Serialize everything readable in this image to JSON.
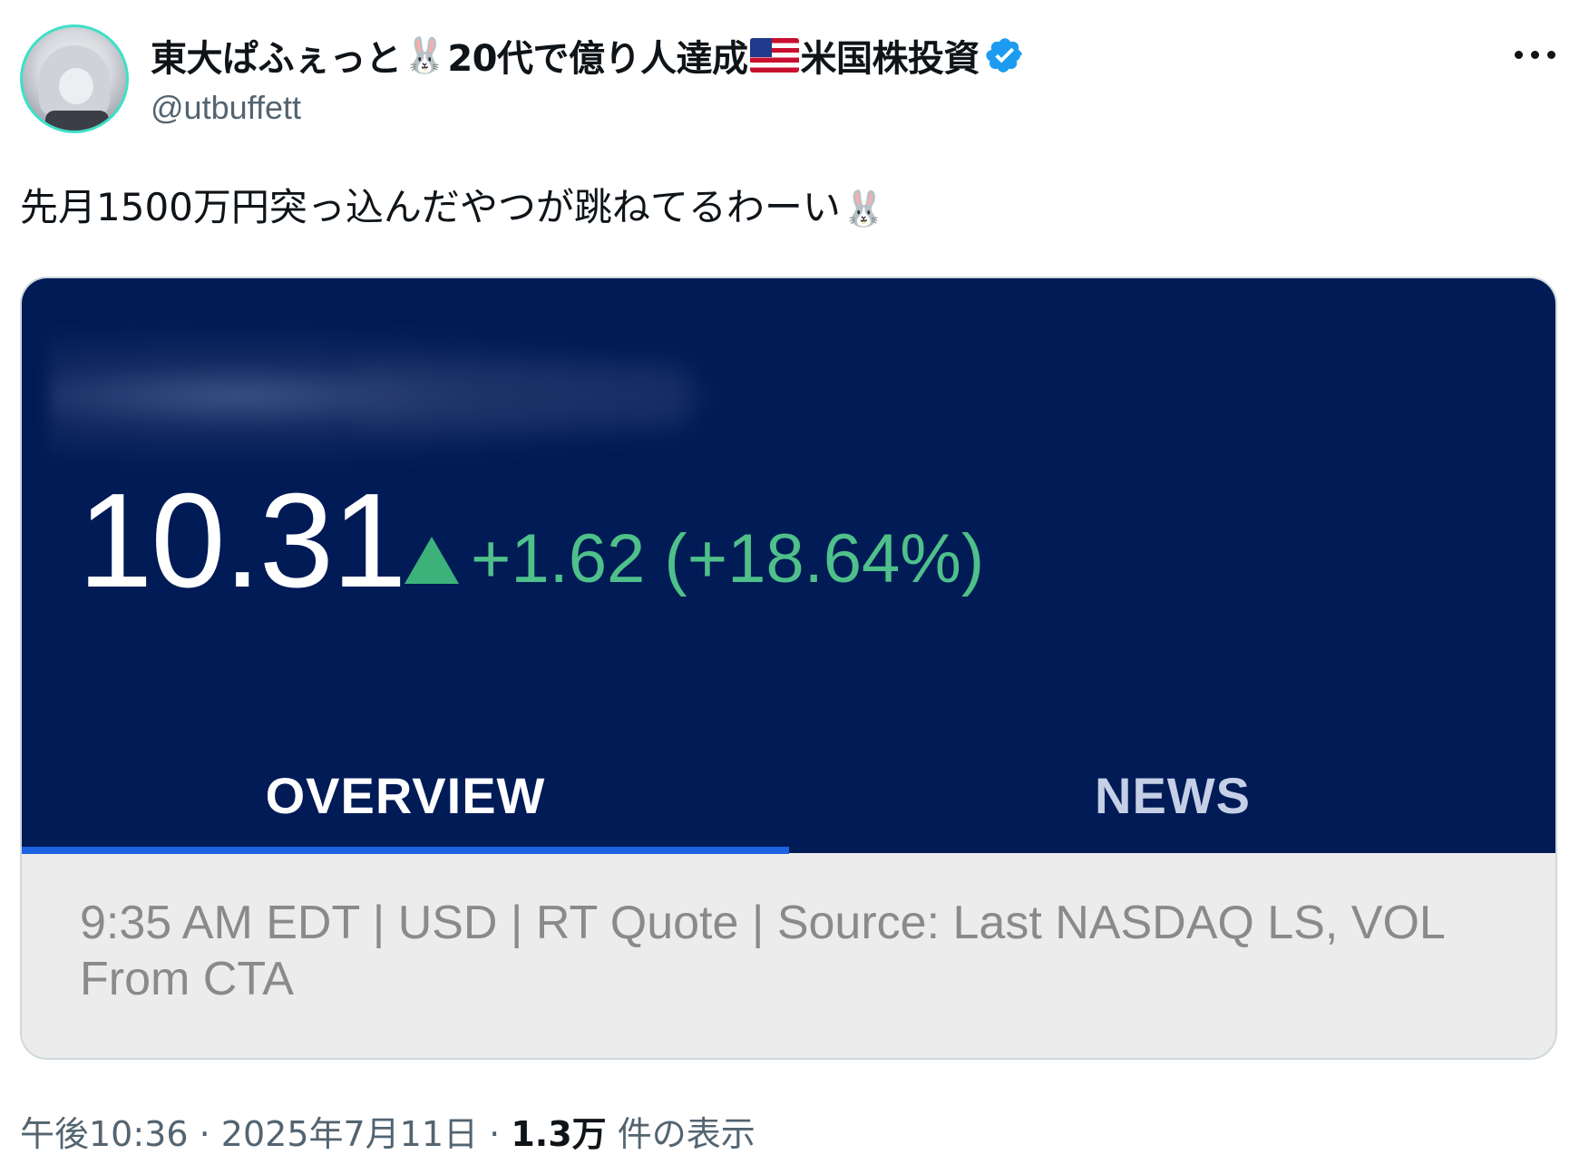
{
  "author": {
    "name_part1": "東大ぱふぇっと",
    "name_part2": "20代で億り人達成",
    "name_part3": "米国株投資",
    "name_emoji": "🐰",
    "handle": "@utbuffett",
    "verified_color": "#1d9bf0"
  },
  "tweet": {
    "text": "先月1500万円突っ込んだやつが跳ねてるわーい",
    "emoji": "🐰"
  },
  "quote_card": {
    "price": "10.31",
    "change": "+1.62 (+18.64%)",
    "change_color": "#4fc08a",
    "background_color": "#001b56",
    "tabs": [
      {
        "label": "OVERVIEW",
        "active": true
      },
      {
        "label": "NEWS",
        "active": false
      }
    ],
    "source_line": "9:35 AM EDT | USD | RT Quote | Source: Last NASDAQ LS, VOL From CTA"
  },
  "meta": {
    "time": "午後10:36",
    "separator": "·",
    "date": "2025年7月11日",
    "views_count": "1.3万",
    "views_label": "件の表示"
  }
}
